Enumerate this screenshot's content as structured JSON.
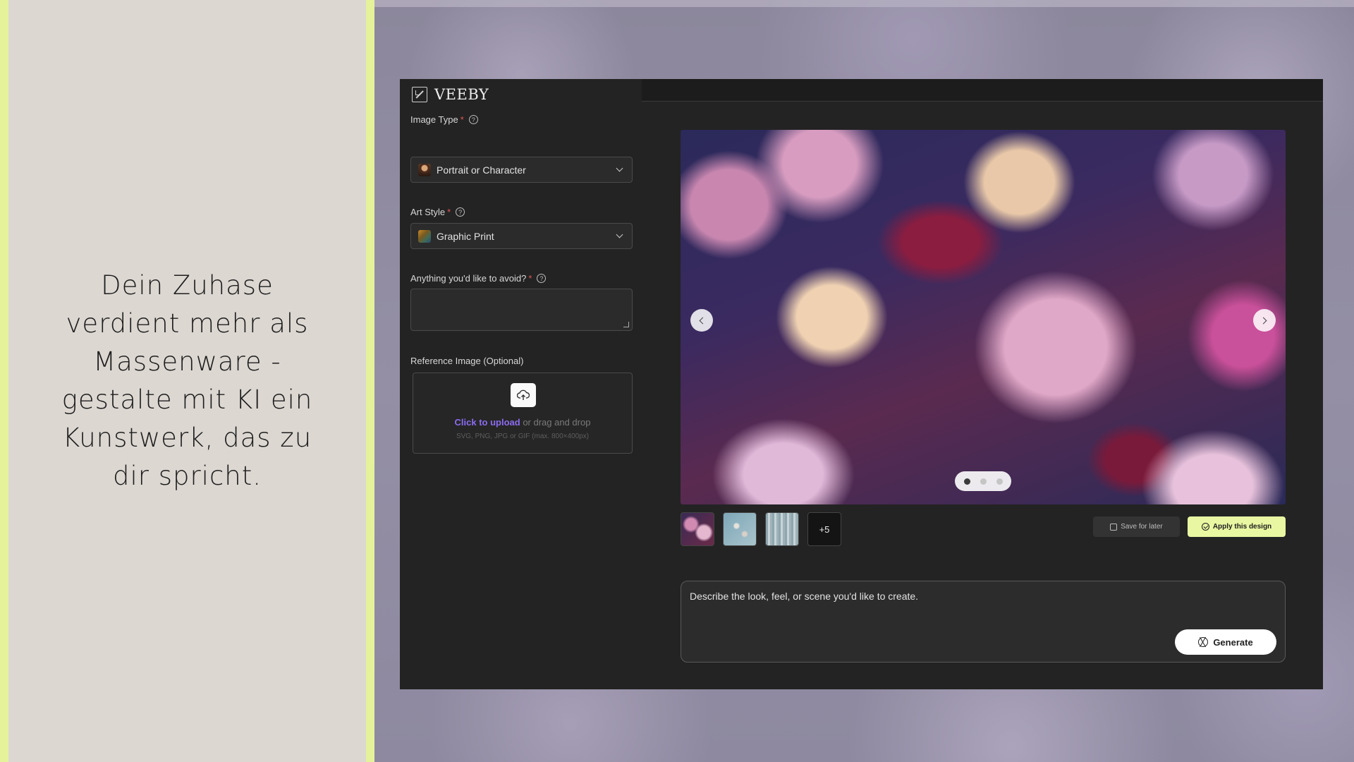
{
  "marketing": {
    "headline": "Dein Zuhase verdient mehr als Massenware - gestalte mit KI ein Kunstwerk, das zu dir spricht."
  },
  "app": {
    "brand": "VEEBY",
    "form": {
      "image_type": {
        "label": "Image Type",
        "value": "Portrait or Character",
        "icon": "portrait-thumb"
      },
      "art_style": {
        "label": "Art Style",
        "value": "Graphic Print",
        "icon": "graphic-print-thumb"
      },
      "avoid": {
        "label": "Anything you'd like to avoid?",
        "value": ""
      },
      "reference": {
        "label": "Reference Image (Optional)",
        "link": "Click to upload",
        "rest": " or drag and drop",
        "hint": "SVG, PNG, JPG or GIF (max. 800×400px)"
      },
      "required_mark": "*",
      "help_glyph": "?"
    },
    "preview": {
      "active_slide": 1,
      "slides": 3,
      "thumbnails_more": "+5"
    },
    "actions": {
      "save_label": "Save for later",
      "apply_label": "Apply this design"
    },
    "prompt": {
      "text": "Describe the look, feel, or scene you'd like to create.",
      "generate_label": "Generate"
    },
    "colors": {
      "accent": "#eaf7a2",
      "link": "#8b6cf0",
      "required": "#e05555"
    }
  }
}
